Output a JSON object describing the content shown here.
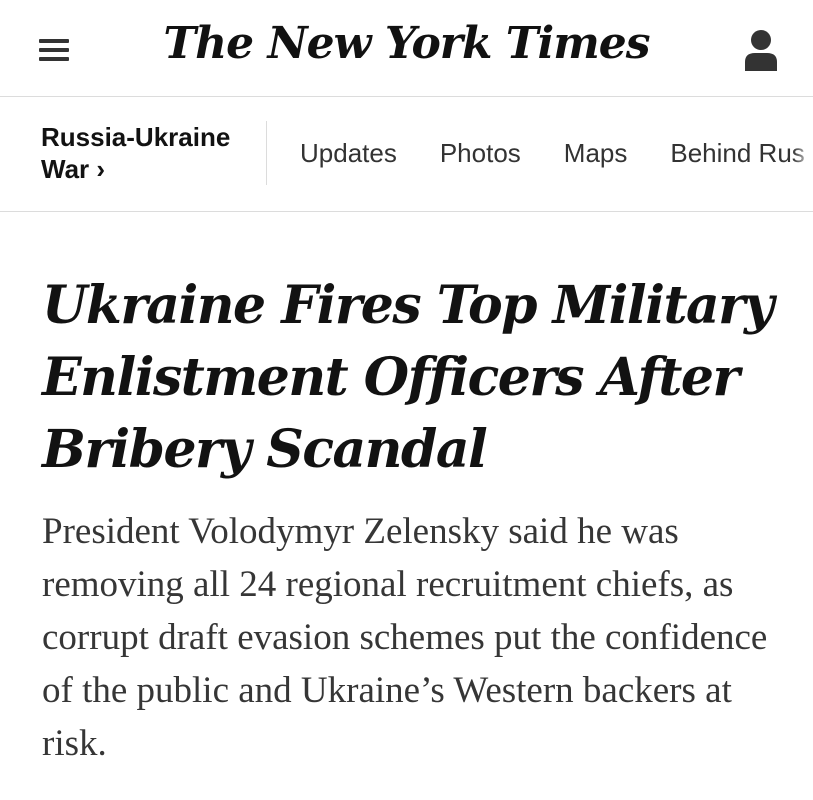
{
  "header": {
    "logo_text": "The New York Times",
    "menu_icon": "hamburger-menu-icon",
    "account_icon": "user-account-icon"
  },
  "section": {
    "title": "Russia-Ukraine War ›",
    "tabs": [
      "Updates",
      "Photos",
      "Maps",
      "Behind Rus"
    ]
  },
  "article": {
    "headline": "Ukraine Fires Top Military Enlistment Officers After Bribery Scandal",
    "summary": "President Volodymyr Zelensky said he was removing all 24 regional recruitment chiefs, as corrupt draft evasion schemes put the confidence of the public and Ukraine’s Western backers at risk."
  },
  "colors": {
    "text": "#121212",
    "summary_text": "#363636",
    "divider": "#dcdcdc"
  }
}
